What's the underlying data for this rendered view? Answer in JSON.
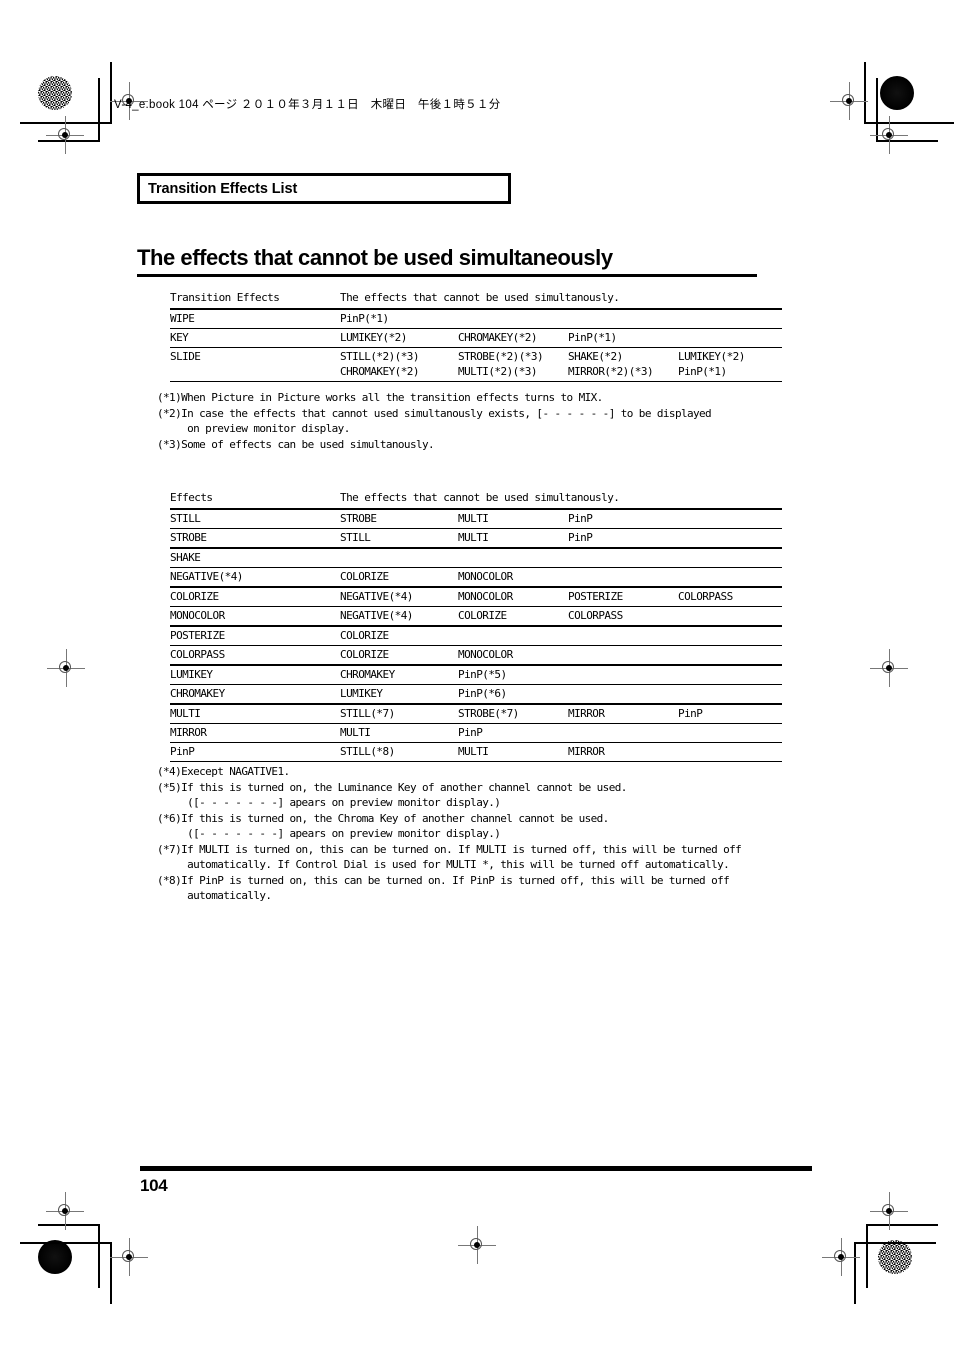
{
  "page": {
    "book_info": "V-4_e.book  104 ページ  ２０１０年３月１１日　木曜日　午後１時５１分",
    "section_label": "Transition Effects List",
    "title": "The effects that cannot be used simultaneously",
    "page_number": "104"
  },
  "table1": {
    "headers": [
      "Transition Effects",
      "The effects that cannot be used simultanously."
    ],
    "rows": [
      {
        "effect": "WIPE",
        "conflicts": [
          "PinP(*1)",
          "",
          "",
          ""
        ],
        "conflicts2": [
          "",
          "",
          "",
          ""
        ]
      },
      {
        "effect": "KEY",
        "conflicts": [
          "LUMIKEY(*2)",
          "CHROMAKEY(*2)",
          "PinP(*1)",
          ""
        ],
        "conflicts2": [
          "",
          "",
          "",
          ""
        ]
      },
      {
        "effect": "SLIDE",
        "conflicts": [
          "STILL(*2)(*3)",
          "STROBE(*2)(*3)",
          "SHAKE(*2)",
          "LUMIKEY(*2)"
        ],
        "conflicts2": [
          "CHROMAKEY(*2)",
          "MULTI(*2)(*3)",
          "MIRROR(*2)(*3)",
          "PinP(*1)"
        ]
      }
    ]
  },
  "notes1": "(*1)When Picture in Picture works all the transition effects turns to MIX.\n(*2)In case the effects that cannot used simultanously exists, [- - - - - -] to be displayed\n     on preview monitor display.\n(*3)Some of effects can be used simultanously.",
  "table2": {
    "headers": [
      "Effects",
      "The effects that cannot be used simultanously."
    ],
    "rows": [
      {
        "effect": "STILL",
        "conflicts": [
          "STROBE",
          "MULTI",
          "PinP",
          ""
        ]
      },
      {
        "effect": "STROBE",
        "conflicts": [
          "STILL",
          "MULTI",
          "PinP",
          ""
        ]
      },
      {
        "effect": "SHAKE",
        "conflicts": [
          "",
          "",
          "",
          ""
        ]
      },
      {
        "effect": "NEGATIVE(*4)",
        "conflicts": [
          "COLORIZE",
          "MONOCOLOR",
          "",
          ""
        ]
      },
      {
        "effect": "COLORIZE",
        "conflicts": [
          "NEGATIVE(*4)",
          "MONOCOLOR",
          "POSTERIZE",
          "COLORPASS"
        ]
      },
      {
        "effect": "MONOCOLOR",
        "conflicts": [
          "NEGATIVE(*4)",
          "COLORIZE",
          "COLORPASS",
          ""
        ]
      },
      {
        "effect": "POSTERIZE",
        "conflicts": [
          "COLORIZE",
          "",
          "",
          ""
        ]
      },
      {
        "effect": "COLORPASS",
        "conflicts": [
          "COLORIZE",
          "MONOCOLOR",
          "",
          ""
        ]
      },
      {
        "effect": "LUMIKEY",
        "conflicts": [
          "CHROMAKEY",
          "PinP(*5)",
          "",
          ""
        ]
      },
      {
        "effect": "CHROMAKEY",
        "conflicts": [
          "LUMIKEY",
          "PinP(*6)",
          "",
          ""
        ]
      },
      {
        "effect": "MULTI",
        "conflicts": [
          "STILL(*7)",
          "STROBE(*7)",
          "MIRROR",
          "PinP"
        ]
      },
      {
        "effect": "MIRROR",
        "conflicts": [
          "MULTI",
          "PinP",
          "",
          ""
        ]
      },
      {
        "effect": "PinP",
        "conflicts": [
          "STILL(*8)",
          "MULTI",
          "MIRROR",
          ""
        ]
      }
    ]
  },
  "notes2": "(*4)Execept NAGATIVE1.\n(*5)If this is turned on, the Luminance Key of another channel cannot be used.\n     ([- - - - - - -] apears on preview monitor display.)\n(*6)If this is turned on, the Chroma Key of another channel cannot be used.\n     ([- - - - - - -] apears on preview monitor display.)\n(*7)If MULTI is turned on, this can be turned on. If MULTI is turned off, this will be turned off\n     automatically. If Control Dial is used for MULTI *, this will be turned off automatically.\n(*8)If PinP is turned on, this can be turned on. If PinP is turned off, this will be turned off\n     automatically."
}
